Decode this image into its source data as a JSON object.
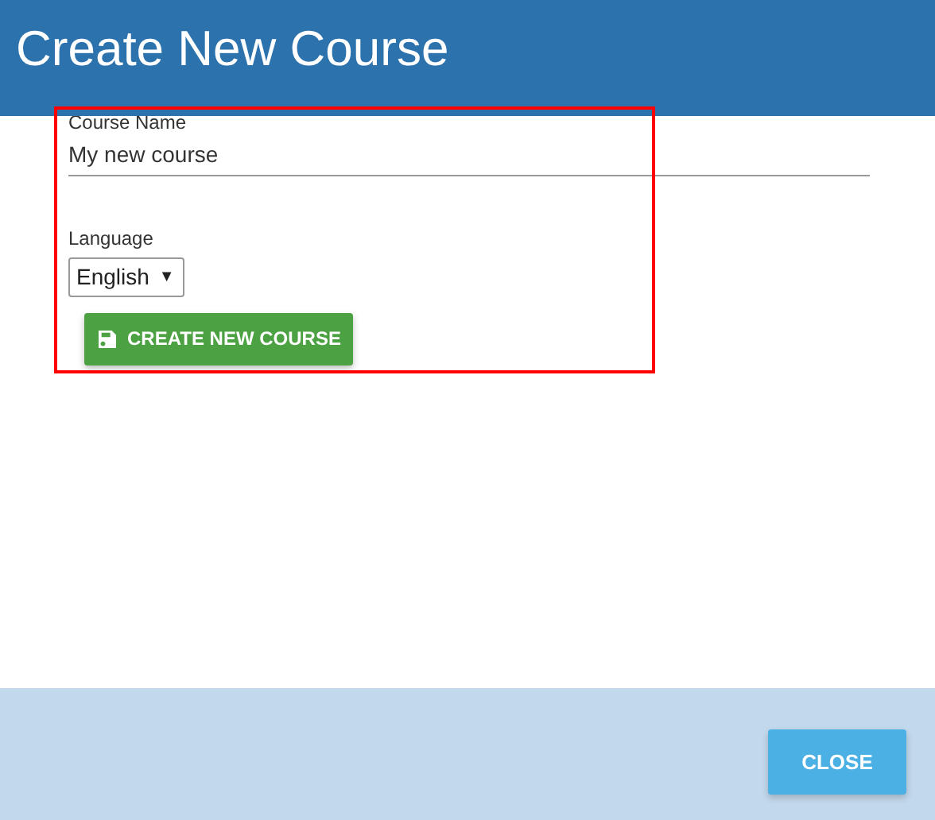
{
  "header": {
    "title": "Create New Course"
  },
  "form": {
    "course_name": {
      "label": "Course Name",
      "value": "My new course"
    },
    "language": {
      "label": "Language",
      "value": "English",
      "caret": "▼"
    },
    "submit_button": {
      "label": "CREATE NEW COURSE"
    }
  },
  "footer": {
    "buttons": [
      "CLOSE"
    ]
  }
}
